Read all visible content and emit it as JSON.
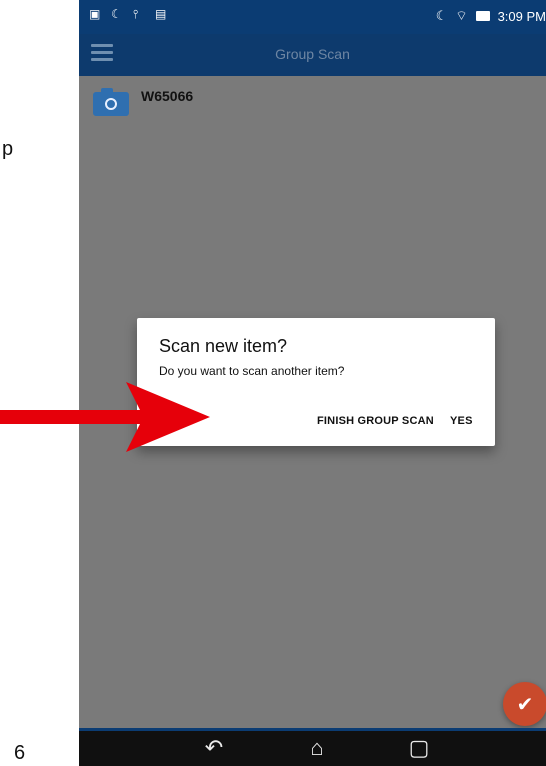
{
  "margin_text": {
    "top": "p",
    "bottom": "6"
  },
  "status_bar": {
    "time": "3:09 PM",
    "icons": [
      "image-icon",
      "moon-icon",
      "usb-icon",
      "photo-icon",
      "moon-icon",
      "wifi-icon",
      "battery-icon"
    ]
  },
  "app_bar": {
    "title": "Group Scan"
  },
  "list": {
    "items": [
      {
        "label": "W65066",
        "icon": "camera-icon"
      }
    ]
  },
  "dialog": {
    "title": "Scan new item?",
    "message": "Do you want to scan another item?",
    "buttons": {
      "finish": "FINISH GROUP SCAN",
      "yes": "YES"
    }
  },
  "fab": {
    "icon": "checkmark-icon"
  },
  "nav_bar": {
    "icons": [
      "back-icon",
      "home-icon",
      "recent-apps-icon"
    ]
  },
  "colors": {
    "app_bar": "#0d3a6d",
    "dim_background": "#7a7a7a",
    "fab": "#c94a2c",
    "arrow": "#e6000a"
  }
}
